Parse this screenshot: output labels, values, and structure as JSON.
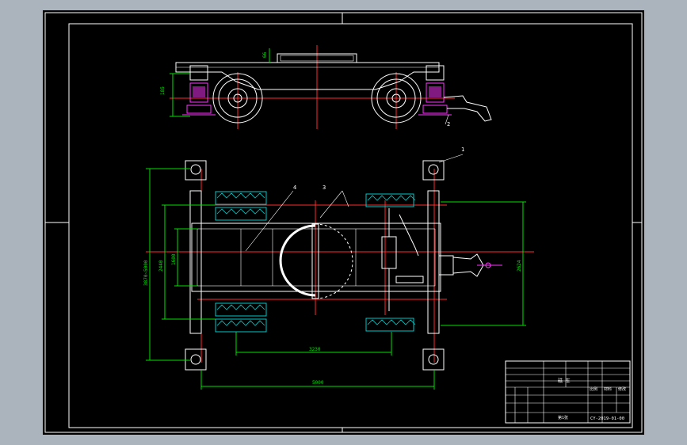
{
  "drawing": {
    "dimensions": {
      "side_height": "185",
      "side_top": "66",
      "wheelbase_inner": "3230",
      "overall_length": "5000",
      "track_vertical": "3870~5000",
      "track_inner_a": "2440",
      "track_inner_b": "1600",
      "right_height": "2624"
    },
    "balloons": [
      "1",
      "2",
      "3",
      "4"
    ]
  },
  "title_block": {
    "name": "磁 车",
    "scale_label": "比例",
    "material_label": "材料",
    "drawing_no": "CY-2019-01-00",
    "sheet_label": "第1张",
    "rev_label": "修改",
    "rows": [
      "",
      "",
      "",
      ""
    ]
  },
  "colors": {
    "paper": "#000000",
    "frame": "#ffffff",
    "part": "#ffffff",
    "centerline": "#ff2a2a",
    "dimension": "#00e000",
    "hatch": "#00c8c8",
    "highlight": "#ff33ff"
  }
}
